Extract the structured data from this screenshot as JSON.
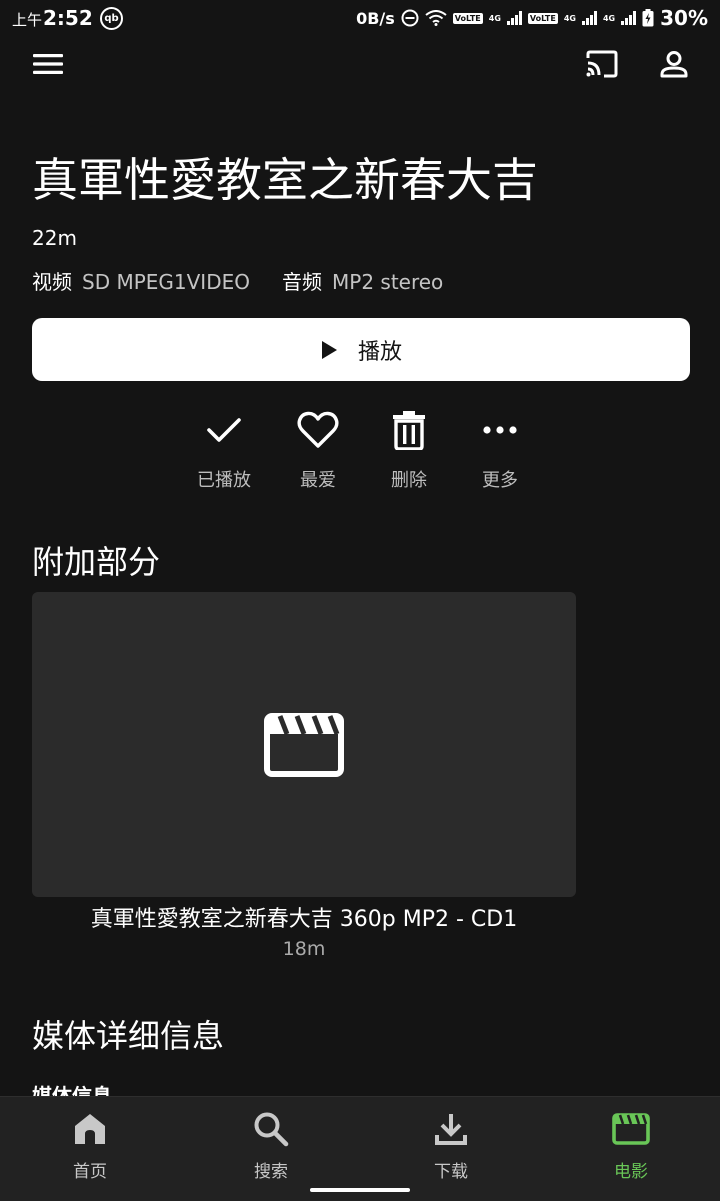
{
  "status_bar": {
    "time_prefix": "上午",
    "time": "2:52",
    "qb_label": "qb",
    "net_speed": "0B/s",
    "volte_1": "VoLTE",
    "sig_1": "4G",
    "volte_2": "VoLTE",
    "sig_2": "4G",
    "sig_3": "4G",
    "battery": "30%"
  },
  "top_bar": {
    "menu_icon": "hamburger-menu-icon",
    "cast_icon": "cast-icon",
    "account_icon": "user-icon"
  },
  "item": {
    "title": "真軍性愛教室之新春大吉",
    "runtime": "22m",
    "video_label": "视频",
    "video_value": "SD MPEG1VIDEO",
    "audio_label": "音频",
    "audio_value": "MP2 stereo"
  },
  "play_button": {
    "label": "播放"
  },
  "actions": [
    {
      "label": "已播放",
      "icon": "check-icon"
    },
    {
      "label": "最爱",
      "icon": "heart-icon"
    },
    {
      "label": "删除",
      "icon": "trash-icon"
    },
    {
      "label": "更多",
      "icon": "more-dots-icon"
    }
  ],
  "extras": {
    "section_title": "附加部分",
    "card_title": "真軍性愛教室之新春大吉 360p MP2 - CD1",
    "card_runtime": "18m"
  },
  "media_details": {
    "section_title": "媒体详细信息",
    "partial_heading": "媒体信息"
  },
  "bottom_nav": [
    {
      "label": "首页",
      "icon": "home-icon",
      "active": false
    },
    {
      "label": "搜索",
      "icon": "search-icon",
      "active": false
    },
    {
      "label": "下载",
      "icon": "download-icon",
      "active": false
    },
    {
      "label": "电影",
      "icon": "movie-clapper-icon",
      "active": true
    }
  ],
  "colors": {
    "background": "#141414",
    "surface": "#222222",
    "card": "#2b2b2b",
    "accent": "#69c657"
  }
}
